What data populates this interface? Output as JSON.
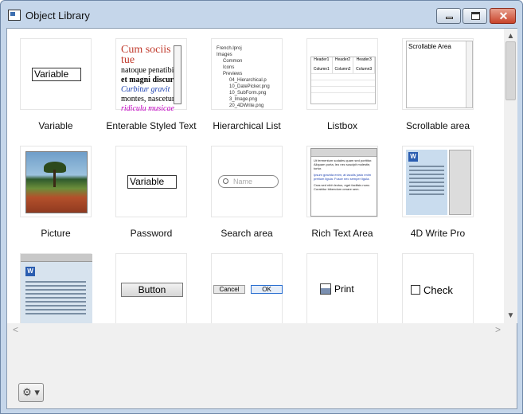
{
  "window": {
    "title": "Object Library",
    "controls": {
      "minimize": "minimize",
      "maximize": "maximize",
      "close": "✕"
    }
  },
  "scroll": {
    "up_arrow": "▲",
    "down_arrow": "▼",
    "left_arrow": "<",
    "right_arrow": ">"
  },
  "objects": [
    {
      "label": "Variable",
      "preview_text": "Variable"
    },
    {
      "label": "Enterable Styled Text",
      "preview_lines": [
        "Cum sociis tue",
        "natoque penatibi",
        "et magni discuri",
        "Curbitur gravit",
        "montes, nascetur",
        "ridiculu musicae"
      ]
    },
    {
      "label": "Hierarchical List",
      "preview_lines": [
        "French.lproj",
        "Images",
        "Common",
        "Icons",
        "Previews",
        "04_Hierarchical.p",
        "10_DatePicker.png",
        "10_SubForm.png",
        "3_Image.png",
        "20_4DWrite.png"
      ]
    },
    {
      "label": "Listbox",
      "headers": [
        "Header1",
        "Header2",
        "Header3"
      ],
      "columns": [
        "Column1",
        "Column2",
        "Column3"
      ]
    },
    {
      "label": "Scrollable area",
      "preview_text": "Scrollable Area"
    },
    {
      "label": "Picture"
    },
    {
      "label": "Password",
      "preview_text": "Variable"
    },
    {
      "label": "Search area",
      "placeholder": "Name"
    },
    {
      "label": "Rich Text Area",
      "preview_lines": [
        "Ut fermentum sodales quam sed porttitor. Aliquam porta, leo nec suscipit molestie, tortor.",
        "Ipsum gravida enim, at iaculis justo enim pretium ligula. Fusce nec semper ligula.",
        "Cras sed nibh lectus, eget facilisis nunc. Curabitur bibendum ornare sem."
      ]
    },
    {
      "label": "4D Write Pro",
      "logo": "W"
    },
    {
      "label": "",
      "logo": "W"
    },
    {
      "label": "",
      "preview_text": "Button"
    },
    {
      "label": "",
      "cancel_text": "Cancel",
      "ok_text": "OK"
    },
    {
      "label": "",
      "preview_text": "Print"
    },
    {
      "label": "",
      "preview_text": "Check"
    }
  ],
  "footer": {
    "gear_menu": "⚙ ▾"
  }
}
